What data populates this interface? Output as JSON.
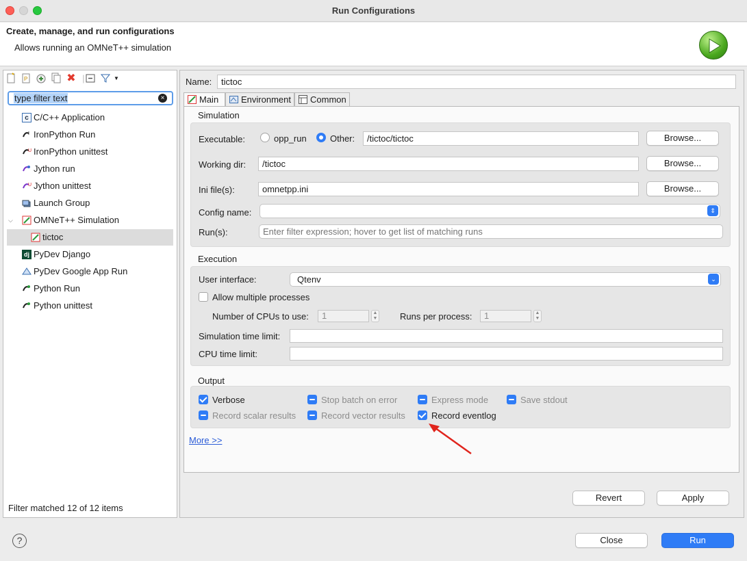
{
  "window": {
    "title": "Run Configurations"
  },
  "header": {
    "title": "Create, manage, and run configurations",
    "description": "Allows running an OMNeT++ simulation"
  },
  "left": {
    "filter_value": "type filter text",
    "tree": [
      {
        "label": "C/C++ Application",
        "icon": "c-app-icon"
      },
      {
        "label": "IronPython Run",
        "icon": "ironpython-icon"
      },
      {
        "label": "IronPython unittest",
        "icon": "ironpython-unittest-icon"
      },
      {
        "label": "Jython run",
        "icon": "jython-icon"
      },
      {
        "label": "Jython unittest",
        "icon": "jython-unittest-icon"
      },
      {
        "label": "Launch Group",
        "icon": "launch-group-icon"
      },
      {
        "label": "OMNeT++ Simulation",
        "icon": "omnet-icon",
        "expanded": true
      },
      {
        "label": "tictoc",
        "icon": "omnet-config-icon",
        "selected": true
      },
      {
        "label": "PyDev Django",
        "icon": "django-icon"
      },
      {
        "label": "PyDev Google App Run",
        "icon": "google-app-icon"
      },
      {
        "label": "Python Run",
        "icon": "python-icon"
      },
      {
        "label": "Python unittest",
        "icon": "python-unittest-icon"
      }
    ],
    "status": "Filter matched 12 of 12 items"
  },
  "config": {
    "name_label": "Name:",
    "name_value": "tictoc",
    "tabs": [
      {
        "label": "Main",
        "active": true
      },
      {
        "label": "Environment"
      },
      {
        "label": "Common"
      }
    ],
    "simulation": {
      "title": "Simulation",
      "executable_label": "Executable:",
      "opp_run_label": "opp_run",
      "other_label": "Other:",
      "executable_value": "/tictoc/tictoc",
      "working_dir_label": "Working dir:",
      "working_dir_value": "/tictoc",
      "ini_label": "Ini file(s):",
      "ini_value": "omnetpp.ini",
      "config_name_label": "Config name:",
      "config_name_value": "",
      "runs_label": "Run(s):",
      "runs_placeholder": "Enter filter expression; hover to get list of matching runs",
      "browse_label": "Browse..."
    },
    "execution": {
      "title": "Execution",
      "ui_label": "User interface:",
      "ui_value": "Qtenv",
      "multi_label": "Allow multiple processes",
      "cpus_label": "Number of CPUs to use:",
      "cpus_value": "1",
      "runs_per_label": "Runs per process:",
      "runs_per_value": "1",
      "sim_time_label": "Simulation time limit:",
      "cpu_time_label": "CPU time limit:"
    },
    "output": {
      "title": "Output",
      "verbose": "Verbose",
      "stop_batch": "Stop batch on error",
      "express": "Express mode",
      "save_stdout": "Save stdout",
      "record_scalar": "Record scalar results",
      "record_vector": "Record vector results",
      "record_eventlog": "Record eventlog"
    },
    "more_link": "More >>",
    "revert": "Revert",
    "apply": "Apply"
  },
  "footer": {
    "help": "?",
    "close": "Close",
    "run": "Run"
  },
  "colors": {
    "accent": "#2f7cf6",
    "annotation": "#e0241c"
  }
}
